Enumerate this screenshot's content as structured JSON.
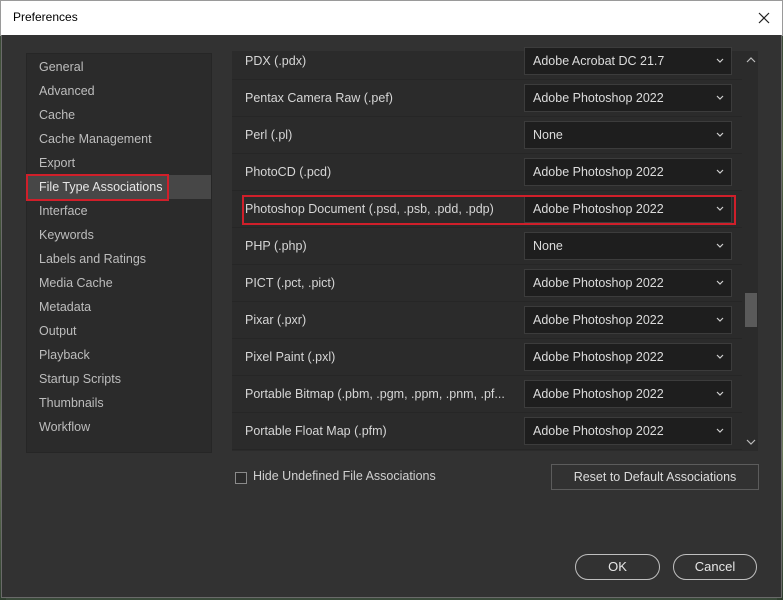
{
  "window": {
    "title": "Preferences"
  },
  "sidebar": {
    "items": [
      {
        "label": "General"
      },
      {
        "label": "Advanced"
      },
      {
        "label": "Cache"
      },
      {
        "label": "Cache Management"
      },
      {
        "label": "Export"
      },
      {
        "label": "File Type Associations",
        "selected": true
      },
      {
        "label": "Interface"
      },
      {
        "label": "Keywords"
      },
      {
        "label": "Labels and Ratings"
      },
      {
        "label": "Media Cache"
      },
      {
        "label": "Metadata"
      },
      {
        "label": "Output"
      },
      {
        "label": "Playback"
      },
      {
        "label": "Startup Scripts"
      },
      {
        "label": "Thumbnails"
      },
      {
        "label": "Workflow"
      }
    ]
  },
  "associations": {
    "rows": [
      {
        "type": "PDX (.pdx)",
        "app": "Adobe Acrobat DC 21.7"
      },
      {
        "type": "Pentax Camera Raw (.pef)",
        "app": "Adobe Photoshop 2022"
      },
      {
        "type": "Perl (.pl)",
        "app": "None"
      },
      {
        "type": "PhotoCD (.pcd)",
        "app": "Adobe Photoshop 2022"
      },
      {
        "type": "Photoshop Document (.psd, .psb, .pdd, .pdp)",
        "app": "Adobe Photoshop 2022",
        "highlighted": true
      },
      {
        "type": "PHP (.php)",
        "app": "None"
      },
      {
        "type": "PICT (.pct, .pict)",
        "app": "Adobe Photoshop 2022"
      },
      {
        "type": "Pixar (.pxr)",
        "app": "Adobe Photoshop 2022"
      },
      {
        "type": "Pixel Paint (.pxl)",
        "app": "Adobe Photoshop 2022"
      },
      {
        "type": "Portable Bitmap (.pbm, .pgm, .ppm, .pnm, .pf...",
        "app": "Adobe Photoshop 2022"
      },
      {
        "type": "Portable Float Map (.pfm)",
        "app": "Adobe Photoshop 2022"
      }
    ]
  },
  "options": {
    "hide_undefined_label": "Hide Undefined File Associations",
    "hide_undefined_checked": false,
    "reset_label": "Reset to Default Associations"
  },
  "footer": {
    "ok_label": "OK",
    "cancel_label": "Cancel"
  },
  "colors": {
    "highlight_red": "#d01f2a",
    "panel_bg": "#2b2b2b",
    "dialog_bg": "#323232"
  },
  "icons": {
    "close": "close-icon",
    "dropdown": "chevron-down-icon",
    "scroll_up": "chevron-up-icon",
    "scroll_down": "chevron-down-icon"
  }
}
